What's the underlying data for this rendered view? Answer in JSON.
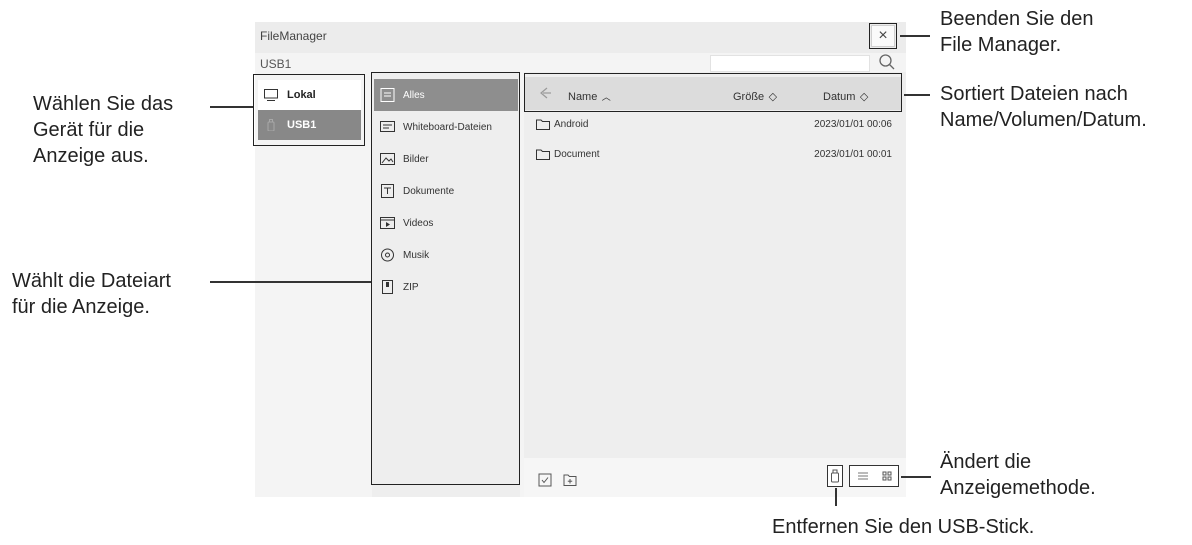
{
  "window": {
    "title": "FileManager",
    "close_label": "×",
    "device_label": "USB1",
    "search_placeholder": ""
  },
  "devices": [
    {
      "label": "Lokal",
      "icon": "monitor-icon",
      "selected": false
    },
    {
      "label": "USB1",
      "icon": "usb-icon",
      "selected": true
    }
  ],
  "categories": [
    {
      "label": "Alles",
      "icon": "all-files-icon",
      "selected": true
    },
    {
      "label": "Whiteboard-Dateien",
      "icon": "whiteboard-icon",
      "selected": false
    },
    {
      "label": "Bilder",
      "icon": "image-icon",
      "selected": false
    },
    {
      "label": "Dokumente",
      "icon": "document-icon",
      "selected": false
    },
    {
      "label": "Videos",
      "icon": "video-icon",
      "selected": false
    },
    {
      "label": "Musik",
      "icon": "music-icon",
      "selected": false
    },
    {
      "label": "ZIP",
      "icon": "zip-icon",
      "selected": false
    }
  ],
  "list_header": {
    "name": "Name",
    "size": "Größe",
    "date": "Datum"
  },
  "files": [
    {
      "name": "Android",
      "date": "2023/01/01 00:06",
      "icon": "folder-icon"
    },
    {
      "name": "Document",
      "date": "2023/01/01 00:01",
      "icon": "folder-icon"
    }
  ],
  "annotations": {
    "exit": [
      "Beenden Sie den",
      "File Manager."
    ],
    "device": [
      "Wählen Sie das",
      "Gerät für die",
      "Anzeige aus."
    ],
    "sort": [
      "Sortiert Dateien nach",
      "Name/Volumen/Datum."
    ],
    "filetype": [
      "Wählt die Dateiart",
      "für die Anzeige."
    ],
    "view": [
      "Ändert die",
      "Anzeigemethode."
    ],
    "usb": "Entfernen Sie den USB-Stick."
  },
  "colors": {
    "selected_bg": "#8e8e8e",
    "pane_bg": "#eeeeee"
  }
}
